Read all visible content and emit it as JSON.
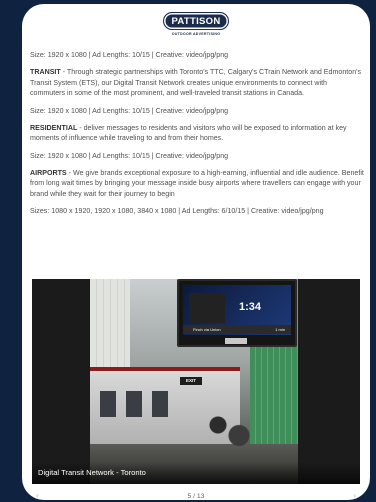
{
  "logo": {
    "name": "PATTISON",
    "tagline": "OUTDOOR ADVERTISING"
  },
  "sections": [
    {
      "heading": "",
      "body": "Size: 1920 x 1080 | Ad Lengths: 10/15 | Creative: video/jpg/png"
    },
    {
      "heading": "TRANSIT",
      "body": " - Through strategic partnerships with Toronto's TTC, Calgary's CTrain Network and Edmonton's Transit System (ETS), our Digital Transit Network creates unique environments to connect with commuters in some of the most prominent, and well-traveled transit stations in Canada."
    },
    {
      "heading": "",
      "body": "Size: 1920 x 1080 | Ad Lengths: 10/15 | Creative: video/jpg/png"
    },
    {
      "heading": "RESIDENTIAL",
      "body": " - deliver messages to residents and visitors who will be exposed to information at key moments of influence while traveling to and from their homes."
    },
    {
      "heading": "",
      "body": "Size: 1920 x 1080 | Ad Lengths: 10/15 | Creative: video/jpg/png"
    },
    {
      "heading": "AIRPORTS",
      "body": " - We give brands exceptional exposure to a high-earning, influential and idle audience. Benefit from long wait times by bringing your message inside busy airports where travellers can engage with your brand while they wait for their journey to begin"
    },
    {
      "heading": "",
      "body": "Sizes: 1080 x 1920, 1920 x 1080, 3840 x 1080 | Ad Lengths: 6/10/15 | Creative: video/jpg/png"
    }
  ],
  "photo": {
    "caption": "Digital Transit Network - Toronto",
    "screen_time": "1:34",
    "screen_route": "Finch via Union",
    "screen_eta": "1 min",
    "exit_sign": "EXIT"
  },
  "pager": {
    "counter": "5 / 13",
    "prev_icon": "chevron-left-icon",
    "next_icon": "chevron-right-icon"
  }
}
